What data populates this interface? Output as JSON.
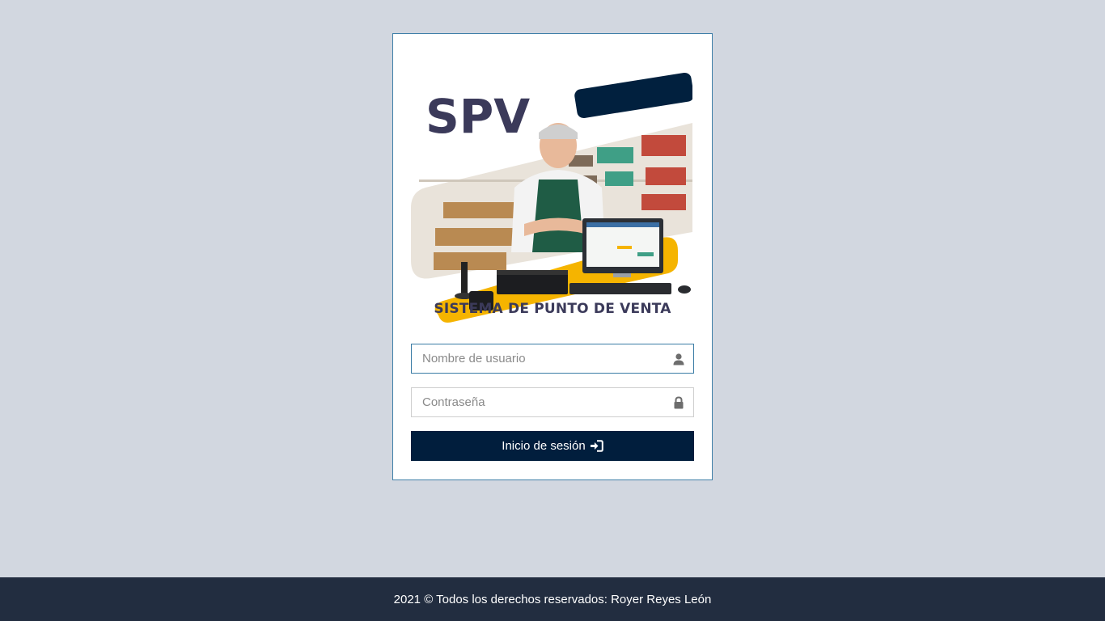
{
  "hero": {
    "logo_text": "SPV",
    "subtitle": "SISTEMA DE PUNTO DE VENTA"
  },
  "form": {
    "username_placeholder": "Nombre de usuario",
    "username_icon": "user-icon",
    "password_placeholder": "Contraseña",
    "password_icon": "lock-icon",
    "submit_label": "Inicio de sesión",
    "submit_icon": "sign-in-icon"
  },
  "footer": {
    "text": "2021 © Todos los derechos reservados: Royer Reyes León"
  },
  "colors": {
    "page_background": "#d2d7e0",
    "primary": "#011e3d",
    "accent_yellow": "#f5b400",
    "footer_background": "#222d40",
    "logo_text": "#3b3a5a"
  }
}
